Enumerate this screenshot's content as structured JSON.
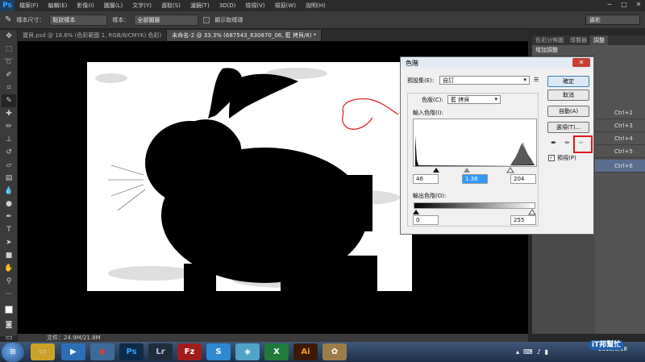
{
  "app": {
    "logo": "Ps"
  },
  "menu": [
    "檔案(F)",
    "編輯(E)",
    "影像(I)",
    "圖層(L)",
    "文字(Y)",
    "選取(S)",
    "濾鏡(T)",
    "3D(D)",
    "檢視(V)",
    "視窗(W)",
    "說明(H)"
  ],
  "window_controls": [
    "─",
    "□",
    "✕"
  ],
  "options": {
    "sample_size_label": "樣本尺寸：",
    "sample_size_value": "點狀樣本",
    "sample_label": "樣本：",
    "sample_value": "全部圖層",
    "show_ring_label": "顯示取樣環"
  },
  "workspace": "攝影",
  "tabs": [
    {
      "label": "寶貝.psd @ 18.6% (色彩範圍 1, RGB/8/CMYK) 色彩)",
      "active": false
    },
    {
      "label": "未命名-2 @ 33.3% (687543_630870_06, 藍 拷貝/8) *",
      "active": true
    }
  ],
  "statusbar": {
    "doc": "文件：24.9M/21.8M"
  },
  "panels": {
    "tabs": [
      "色彩分佈圖",
      "導覽器",
      "調整"
    ],
    "add_adjustment": "增加調整",
    "shortcuts": [
      "Ctrl+2",
      "Ctrl+3",
      "Ctrl+4",
      "Ctrl+5",
      "Ctrl+6"
    ]
  },
  "dialog": {
    "title": "色階",
    "close": "✕",
    "preset_label": "預設集(E):",
    "preset_value": "自訂",
    "channel_label": "色版(C):",
    "channel_value": "藍 拷貝",
    "input_levels_label": "輸入色階(I):",
    "input_black": "46",
    "input_gamma": "1.38",
    "input_white": "204",
    "output_levels_label": "輸出色階(O):",
    "output_black": "0",
    "output_white": "255",
    "buttons": {
      "ok": "確定",
      "cancel": "取消",
      "auto": "自動(A)",
      "options": "選項(T)..."
    },
    "preview_label": "預視(P)"
  },
  "taskbar": {
    "apps": [
      "folder",
      "media",
      "chrome",
      "Ps",
      "Lr",
      "Fz",
      "skype",
      "app",
      "excel",
      "Ai",
      "paint"
    ],
    "clock_date": "2013/9/18"
  },
  "watermark": "iT邦幫忙",
  "colors": {
    "accent_red": "#e0181e",
    "ps_blue": "#38a3ff",
    "canvas": "#000000"
  }
}
